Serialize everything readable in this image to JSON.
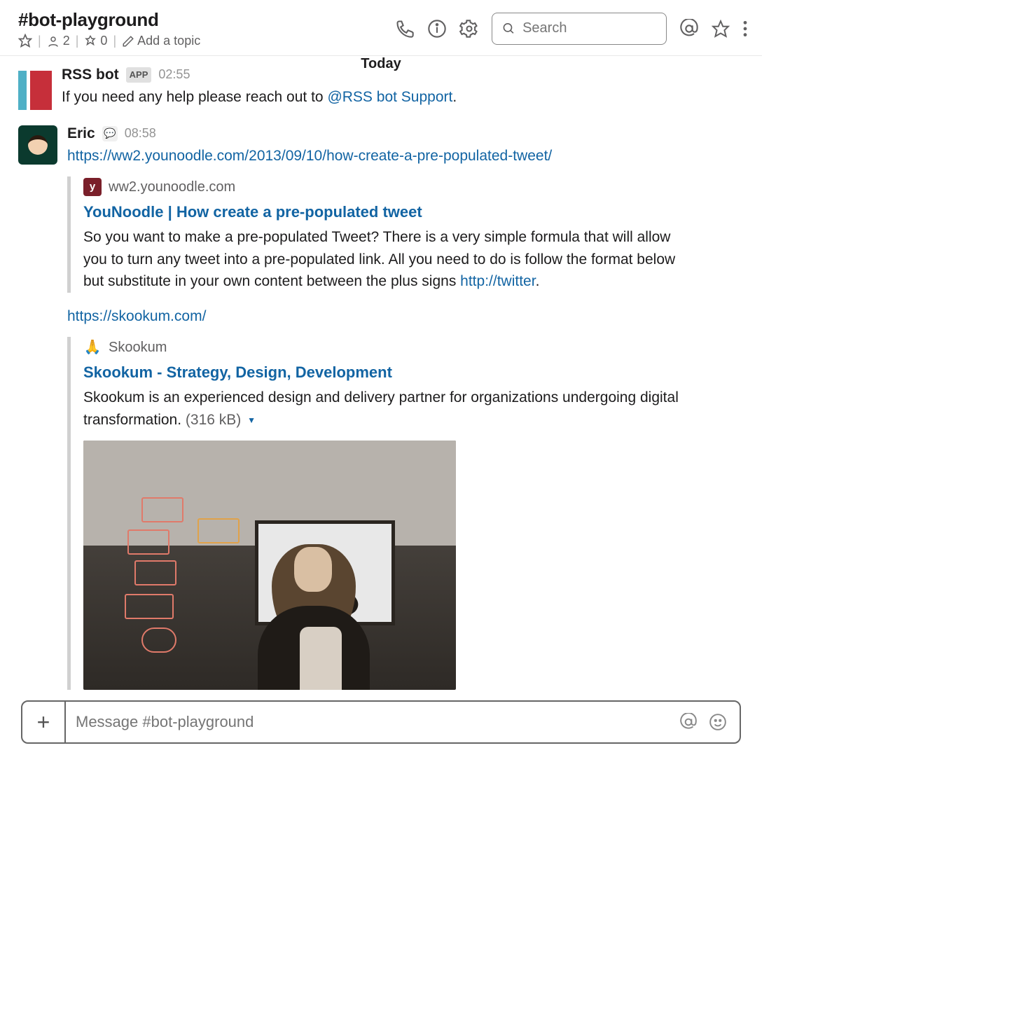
{
  "header": {
    "channel_name": "#bot-playground",
    "members": "2",
    "pins": "0",
    "add_topic": "Add a topic",
    "search_placeholder": "Search"
  },
  "divider": "Today",
  "rss": {
    "author": "RSS bot",
    "badge": "APP",
    "time": "02:55",
    "text_prefix": "If you need any help please reach out to ",
    "mention": "@RSS bot Support",
    "text_suffix": "."
  },
  "eric": {
    "author": "Eric",
    "status_emoji": "💬",
    "time": "08:58",
    "link1": "https://ww2.younoodle.com/2013/09/10/how-create-a-pre-populated-tweet/",
    "unfurl1": {
      "site": "ww2.younoodle.com",
      "site_letter": "y",
      "title": "YouNoodle | How create a pre-populated tweet",
      "desc_part1": "So you want to make a pre-populated Tweet? There is a very simple formula that will allow you to turn any tweet into a pre-populated link. All you need to do is follow the format below but substitute in your own content between the plus signs ",
      "embedded_link": "http://twitter",
      "desc_part2": "."
    },
    "link2": "https://skookum.com/",
    "unfurl2": {
      "site": "Skookum",
      "site_icon": "🙏",
      "title": "Skookum - Strategy, Design, Development",
      "desc": "Skookum is an experienced design and delivery partner for organizations undergoing digital transformation.",
      "size": "(316 kB)"
    }
  },
  "compose": {
    "placeholder": "Message #bot-playground"
  }
}
